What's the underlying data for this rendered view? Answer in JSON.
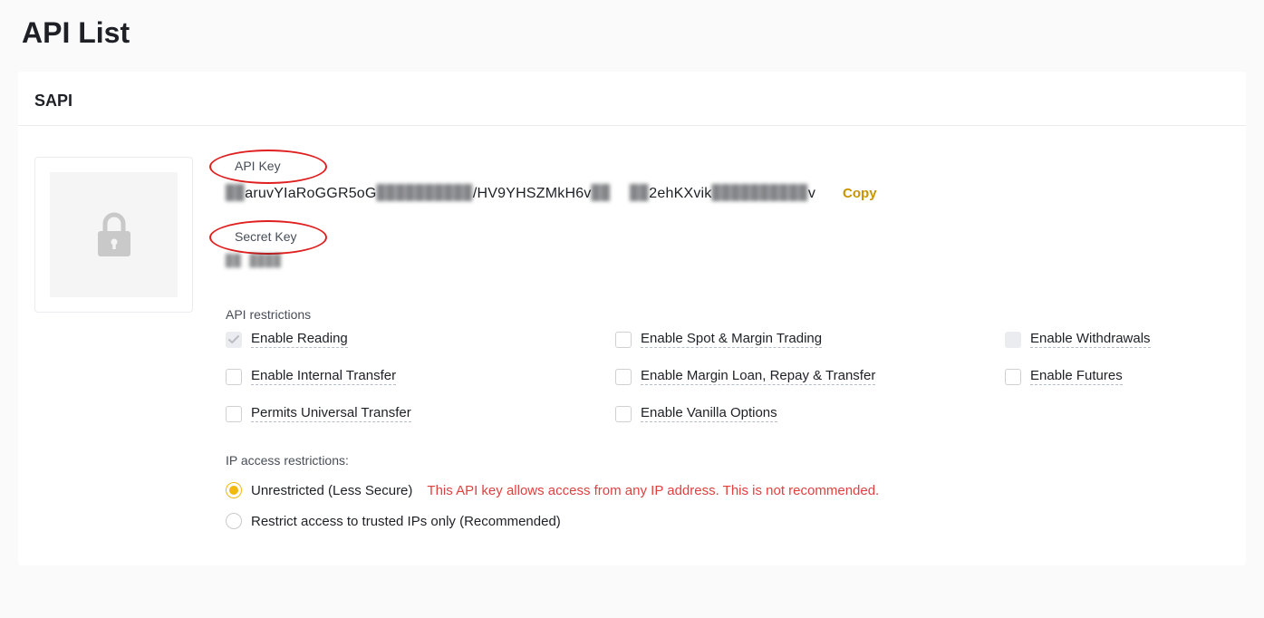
{
  "page": {
    "title": "API List"
  },
  "card": {
    "name": "SAPI"
  },
  "api_key": {
    "label": "API Key",
    "value_seg1": "aruvYIaRoGGR5oG",
    "value_seg2": "/HV9YHSZMkH6v",
    "value_seg3": "2ehKXvik",
    "value_seg4": "v",
    "copy": "Copy"
  },
  "secret_key": {
    "label": "Secret Key",
    "hidden_placeholder": ""
  },
  "restrictions": {
    "title": "API restrictions",
    "items": [
      {
        "label": "Enable Reading",
        "checked": true,
        "locked": true
      },
      {
        "label": "Enable Spot & Margin Trading",
        "checked": false,
        "locked": false
      },
      {
        "label": "Enable Withdrawals",
        "checked": false,
        "locked": true
      },
      {
        "label": "Enable Internal Transfer",
        "checked": false,
        "locked": false
      },
      {
        "label": "Enable Margin Loan, Repay & Transfer",
        "checked": false,
        "locked": false
      },
      {
        "label": "Enable Futures",
        "checked": false,
        "locked": false
      },
      {
        "label": "Permits Universal Transfer",
        "checked": false,
        "locked": false
      },
      {
        "label": "Enable Vanilla Options",
        "checked": false,
        "locked": false
      }
    ]
  },
  "ip": {
    "title": "IP access restrictions:",
    "options": {
      "unrestricted_label": "Unrestricted (Less Secure)",
      "unrestricted_warning": "This API key allows access from any IP address. This is not recommended.",
      "restricted_label": "Restrict access to trusted IPs only (Recommended)"
    }
  }
}
